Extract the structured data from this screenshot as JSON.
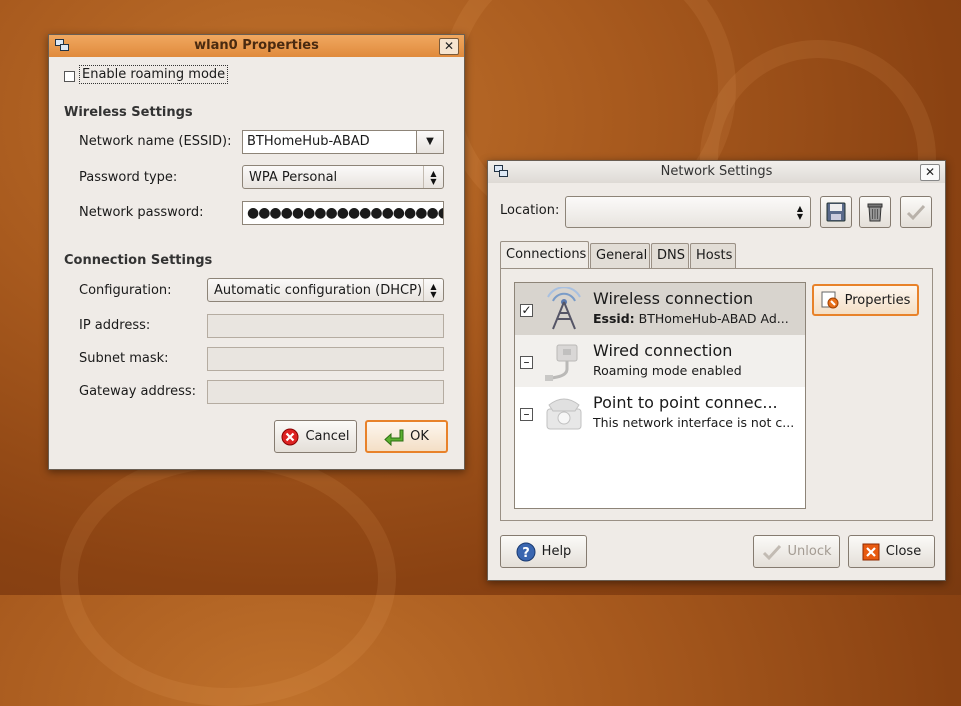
{
  "wlan_dialog": {
    "title": "wlan0 Properties",
    "enable_roaming_label": "Enable roaming mode",
    "enable_roaming_checked": false,
    "wireless_section": "Wireless Settings",
    "essid_label": "Network name (ESSID):",
    "essid_value": "BTHomeHub-ABAD",
    "password_type_label": "Password type:",
    "password_type_value": "WPA Personal",
    "password_label": "Network password:",
    "password_value": "●●●●●●●●●●●●●●●●●●●●",
    "connection_section": "Connection Settings",
    "configuration_label": "Configuration:",
    "configuration_value": "Automatic configuration (DHCP)",
    "ip_label": "IP address:",
    "ip_value": "",
    "subnet_label": "Subnet mask:",
    "subnet_value": "",
    "gateway_label": "Gateway address:",
    "gateway_value": "",
    "cancel_label": "Cancel",
    "ok_label": "OK"
  },
  "network_dialog": {
    "title": "Network Settings",
    "location_label": "Location:",
    "location_value": "",
    "tabs": [
      {
        "label": "Connections",
        "active": true
      },
      {
        "label": "General",
        "active": false
      },
      {
        "label": "DNS",
        "active": false
      },
      {
        "label": "Hosts",
        "active": false
      }
    ],
    "connections": [
      {
        "title": "Wireless connection",
        "essid_prefix": "Essid:",
        "subtitle": "BTHomeHub-ABAD Ad...",
        "checked": true,
        "icon": "wireless-tower-icon"
      },
      {
        "title": "Wired connection",
        "subtitle": "Roaming mode enabled",
        "checked": false,
        "icon": "wired-network-icon"
      },
      {
        "title": "Point to point connec...",
        "subtitle": "This network interface is not c...",
        "checked": false,
        "icon": "telephone-modem-icon"
      }
    ],
    "properties_label": "Properties",
    "help_label": "Help",
    "unlock_label": "Unlock",
    "close_label": "Close"
  },
  "colors": {
    "active_titlebar": "#e08a3c",
    "focus_border": "#e8822a",
    "desktop": "#a85a1e"
  }
}
